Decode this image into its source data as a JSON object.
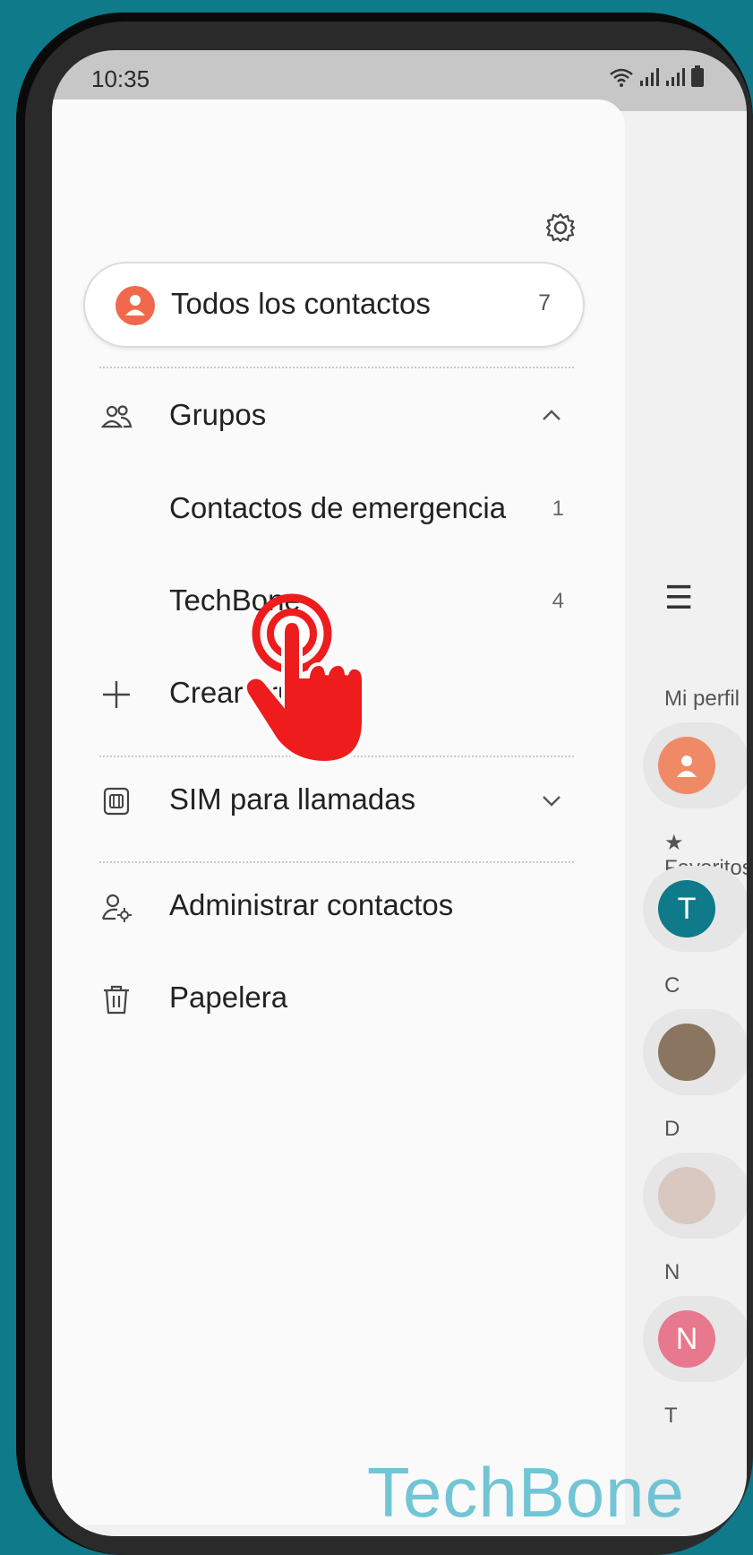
{
  "status_bar": {
    "time": "10:35",
    "icons": [
      "wifi-icon",
      "signal-icon",
      "signal-icon",
      "battery-icon"
    ]
  },
  "drawer": {
    "all_contacts": {
      "label": "Todos los contactos",
      "count": "7"
    },
    "groups": {
      "label": "Grupos",
      "items": [
        {
          "label": "Contactos de emergencia",
          "count": "1"
        },
        {
          "label": "TechBone",
          "count": "4"
        }
      ],
      "create_label": "Crear grupo"
    },
    "sim_label": "SIM para llamadas",
    "manage_label": "Administrar contactos",
    "trash_label": "Papelera"
  },
  "background": {
    "my_profile": "Mi perfil",
    "favorites": "Favoritos",
    "sections": [
      "C",
      "D",
      "N",
      "T"
    ],
    "avatar_letters": [
      "T",
      "N"
    ]
  },
  "watermark": "TechBone",
  "colors": {
    "accent": "#f0694d",
    "teal": "#0f7a8a",
    "hand": "#ee1c1c"
  }
}
